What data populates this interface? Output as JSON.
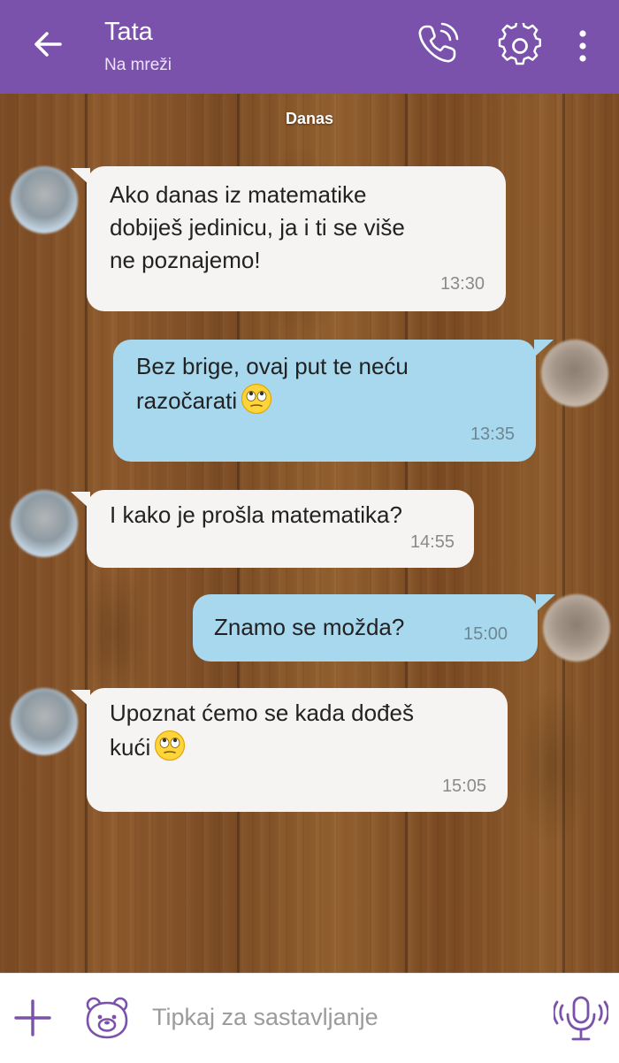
{
  "header": {
    "contact_name": "Tata",
    "status": "Na mreži",
    "back_icon": "arrow-left-icon",
    "call_icon": "phone-ringing-icon",
    "settings_icon": "gear-icon",
    "menu_icon": "more-vertical-icon"
  },
  "chat": {
    "date_divider": "Danas",
    "messages": [
      {
        "direction": "incoming",
        "lines": [
          "Ako danas iz matematike",
          "dobiješ jedinicu, ja i ti se više",
          "ne poznajemo!"
        ],
        "time": "13:30"
      },
      {
        "direction": "outgoing",
        "lines": [
          "Bez brige, ovaj put te neću",
          "razočarati"
        ],
        "emoji": "rolling-eyes-emoji",
        "time": "13:35"
      },
      {
        "direction": "incoming",
        "lines": [
          "I kako je prošla matematika?"
        ],
        "time": "14:55"
      },
      {
        "direction": "outgoing",
        "lines": [
          "Znamo se možda?"
        ],
        "time": "15:00"
      },
      {
        "direction": "incoming",
        "lines": [
          "Upoznat ćemo se kada dođeš",
          "kući"
        ],
        "emoji": "rolling-eyes-emoji",
        "time": "15:05"
      }
    ]
  },
  "composer": {
    "placeholder": "Tipkaj za sastavljanje",
    "plus_icon": "plus-icon",
    "sticker_icon": "sticker-bear-icon",
    "mic_icon": "microphone-icon"
  },
  "colors": {
    "header_bg": "#7b52ab",
    "incoming_bubble": "#f5f4f2",
    "outgoing_bubble": "#a7d8ee",
    "composer_accent": "#7b52ab"
  }
}
